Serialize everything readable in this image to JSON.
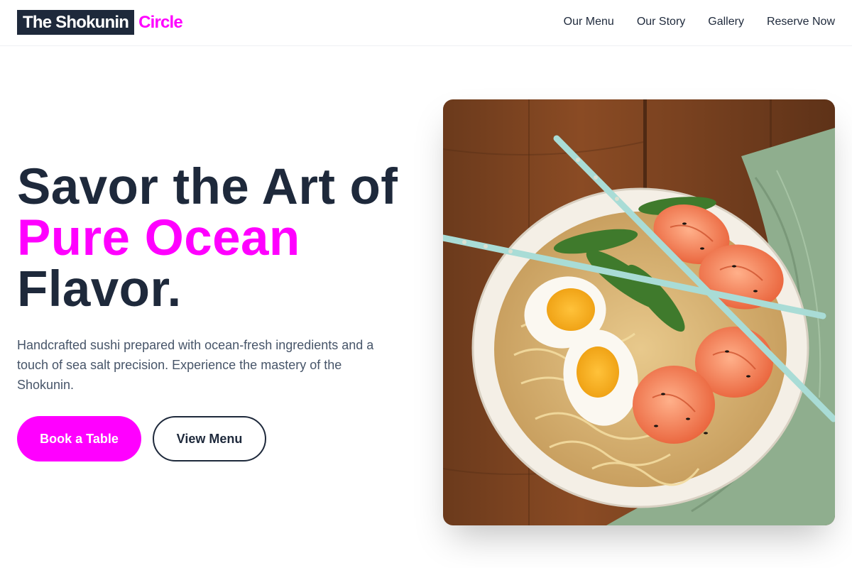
{
  "brand": {
    "name": "The Shokunin",
    "accent": "Circle"
  },
  "nav": [
    {
      "label": "Our Menu"
    },
    {
      "label": "Our Story"
    },
    {
      "label": "Gallery"
    },
    {
      "label": "Reserve Now"
    }
  ],
  "hero": {
    "headline": {
      "line1": "Savor the Art of",
      "line2": "Pure Ocean",
      "line3": "Flavor."
    },
    "description": "Handcrafted sushi prepared with ocean-fresh ingredients and a touch of sea salt precision. Experience the mastery of the Shokunin.",
    "primary_cta": "Book a Table",
    "secondary_cta": "View Menu",
    "image_subject": "ramen bowl with shrimp, soft-boiled eggs, snow peas and chopsticks"
  },
  "colors": {
    "accent": "#ff00ff",
    "dark": "#1e293b",
    "muted": "#475569"
  }
}
